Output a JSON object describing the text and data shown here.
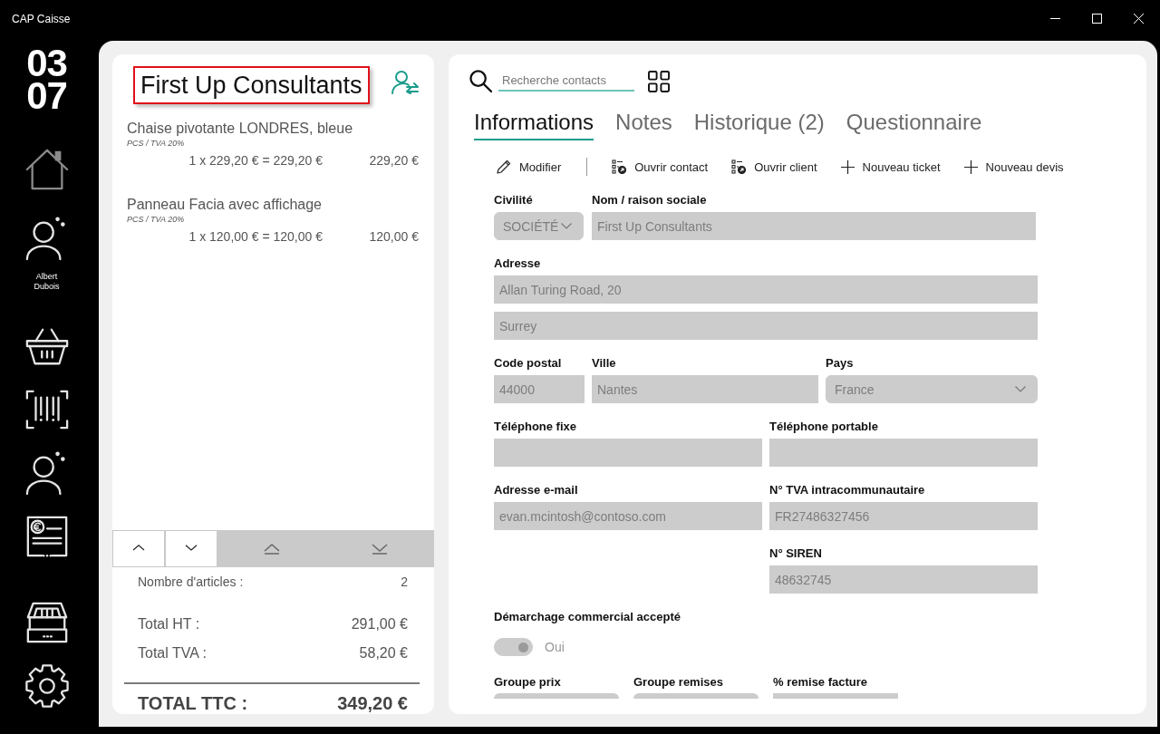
{
  "window": {
    "title": "CAP Caisse"
  },
  "sidebar": {
    "display": [
      "03",
      "07"
    ],
    "items": [
      {
        "kind": "home",
        "disabled": true
      },
      {
        "kind": "user",
        "label": "Albert Dubois",
        "disabled": false
      },
      {
        "kind": "basket",
        "disabled": false
      },
      {
        "kind": "barcode",
        "disabled": false
      },
      {
        "kind": "user-add",
        "disabled": false
      },
      {
        "kind": "receipt",
        "disabled": false
      }
    ],
    "bottom_items": [
      {
        "kind": "drawer",
        "disabled": false
      },
      {
        "kind": "settings",
        "disabled": false
      }
    ]
  },
  "cart": {
    "customer": {
      "name": "First Up Consultants",
      "highlighted": true
    },
    "lines": [
      {
        "name": "Chaise pivotante LONDRES, bleue",
        "unit": "PCS / TVA 20%",
        "calculation": "1 x 229,20 € = 229,20 €",
        "amount": "229,20 €"
      },
      {
        "name": "Panneau Facia avec affichage",
        "unit": "PCS / TVA 20%",
        "calculation": "1 x 120,00 € = 120,00 €",
        "amount": "120,00 €"
      }
    ],
    "scroll_buttons": [
      {
        "kind": "line-up",
        "disabled": false
      },
      {
        "kind": "line-down",
        "disabled": false
      },
      {
        "kind": "page-up",
        "disabled": true
      },
      {
        "kind": "page-down",
        "disabled": true
      }
    ],
    "article_count": {
      "label": "Nombre d'articles :",
      "value": "2"
    },
    "totals": [
      {
        "label": "Total HT :",
        "value": "291,00 €"
      },
      {
        "label": "Total TVA :",
        "value": "58,20 €"
      }
    ],
    "grand_total": {
      "label": "TOTAL TTC :",
      "value": "349,20 €"
    }
  },
  "contact": {
    "search": {
      "placeholder": "Recherche contacts"
    },
    "tabs": [
      {
        "label": "Informations",
        "selected": true
      },
      {
        "label": "Notes",
        "selected": false
      },
      {
        "label": "Historique (2)",
        "selected": false
      },
      {
        "label": "Questionnaire",
        "selected": false
      }
    ],
    "actions": [
      {
        "kind": "edit",
        "label": "Modifier"
      },
      {
        "kind": "open",
        "label": "Ouvrir contact"
      },
      {
        "kind": "open",
        "label": "Ouvrir client"
      },
      {
        "kind": "add",
        "label": "Nouveau ticket"
      },
      {
        "kind": "add",
        "label": "Nouveau devis"
      }
    ],
    "form": {
      "disabled": true,
      "civility": {
        "kind": "select",
        "label": "Civilité",
        "value": "SOCIÉTÉ"
      },
      "name": {
        "kind": "text",
        "label": "Nom / raison sociale",
        "value": "First Up Consultants"
      },
      "address": {
        "label": "Adresse",
        "lines": [
          "Allan Turing Road, 20",
          "Surrey"
        ]
      },
      "postal_code": {
        "kind": "text",
        "label": "Code postal",
        "value": "44000"
      },
      "city": {
        "kind": "text",
        "label": "Ville",
        "value": "Nantes"
      },
      "country": {
        "kind": "select",
        "label": "Pays",
        "value": "France"
      },
      "phone": {
        "kind": "text",
        "label": "Téléphone fixe"
      },
      "mobile": {
        "kind": "text",
        "label": "Téléphone portable"
      },
      "email": {
        "kind": "text",
        "label": "Adresse e-mail",
        "value": "evan.mcintosh@contoso.com"
      },
      "vat_number": {
        "kind": "text",
        "label": "N° TVA intracommunautaire",
        "value": "FR27486327456"
      },
      "siren": {
        "kind": "text",
        "label": "N° SIREN",
        "value": "48632745"
      },
      "marketing": {
        "label": "Démarchage commercial accepté",
        "on": true,
        "text": "Oui"
      },
      "groups": [
        {
          "kind": "select",
          "label": "Groupe prix"
        },
        {
          "kind": "select",
          "label": "Groupe remises"
        },
        {
          "kind": "text",
          "label": "% remise facture"
        }
      ]
    }
  }
}
